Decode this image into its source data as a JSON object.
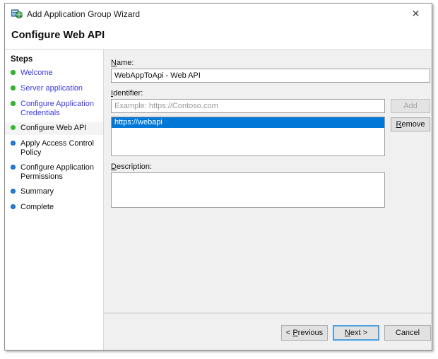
{
  "window": {
    "title": "Add Application Group Wizard",
    "icon": "app-group-wizard-icon",
    "close_label": "✕"
  },
  "header": {
    "title": "Configure Web API"
  },
  "sidebar": {
    "heading": "Steps",
    "items": [
      {
        "label": "Welcome",
        "state": "done"
      },
      {
        "label": "Server application",
        "state": "done"
      },
      {
        "label": "Configure Application Credentials",
        "state": "done"
      },
      {
        "label": "Configure Web API",
        "state": "current"
      },
      {
        "label": "Apply Access Control Policy",
        "state": "todo"
      },
      {
        "label": "Configure Application Permissions",
        "state": "todo"
      },
      {
        "label": "Summary",
        "state": "todo"
      },
      {
        "label": "Complete",
        "state": "todo"
      }
    ]
  },
  "form": {
    "name_label": "Name:",
    "name_value": "WebAppToApi - Web API",
    "identifier_label": "Identifier:",
    "identifier_value": "",
    "identifier_placeholder": "Example: https://Contoso.com",
    "add_label": "Add",
    "add_enabled": false,
    "remove_label": "Remove",
    "remove_enabled": true,
    "identifiers": [
      {
        "value": "https://webapi",
        "selected": true
      }
    ],
    "description_label": "Description:",
    "description_value": ""
  },
  "footer": {
    "previous_label": "< Previous",
    "next_label": "Next >",
    "cancel_label": "Cancel"
  },
  "colors": {
    "accent": "#0078d7",
    "step_done": "#2fbc2f",
    "step_todo": "#1f7fd6",
    "link": "#3b3bdd",
    "panel": "#f0f0f0"
  }
}
